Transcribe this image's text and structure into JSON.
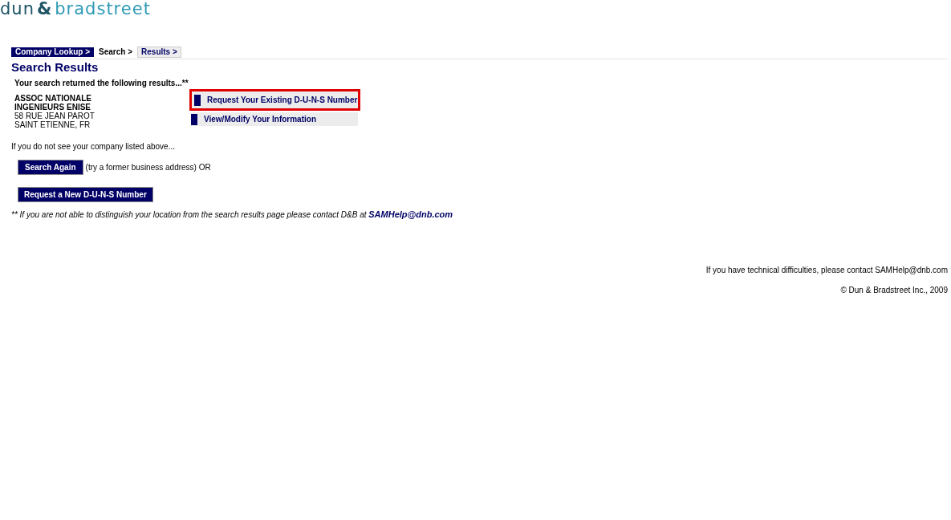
{
  "logo": {
    "left": "dun",
    "mark": "&",
    "right": "bradstreet"
  },
  "breadcrumb": [
    {
      "label": "Company Lookup >",
      "kind": "done"
    },
    {
      "label": "Search >",
      "kind": "plain"
    },
    {
      "label": "Results >",
      "kind": "tab"
    }
  ],
  "title": "Search Results",
  "intro": "Your search returned the following results...**",
  "result": {
    "name_lines": [
      "ASSOC NATIONALE",
      "INGENIEURS ENISE"
    ],
    "address_lines": [
      "58 RUE JEAN PAROT",
      "SAINT ETIENNE, FR"
    ]
  },
  "options": [
    {
      "label": "Request Your Existing D-U-N-S Number",
      "highlighted": true
    },
    {
      "label": "View/Modify Your Information",
      "highlighted": false
    }
  ],
  "not_listed": "If you do not see your company listed above...",
  "search_again": {
    "button": "Search Again",
    "hint": "(try a former business address) OR"
  },
  "new_duns_button": "Request a New D-U-N-S Number",
  "note": {
    "mark": "**",
    "text": "If you are not able to distinguish your location from the search results page please contact D&B at",
    "link": "SAMHelp@dnb.com"
  },
  "footer": [
    "If you have technical difficulties, please contact SAMHelp@dnb.com",
    "© Dun & Bradstreet Inc., 2009"
  ]
}
